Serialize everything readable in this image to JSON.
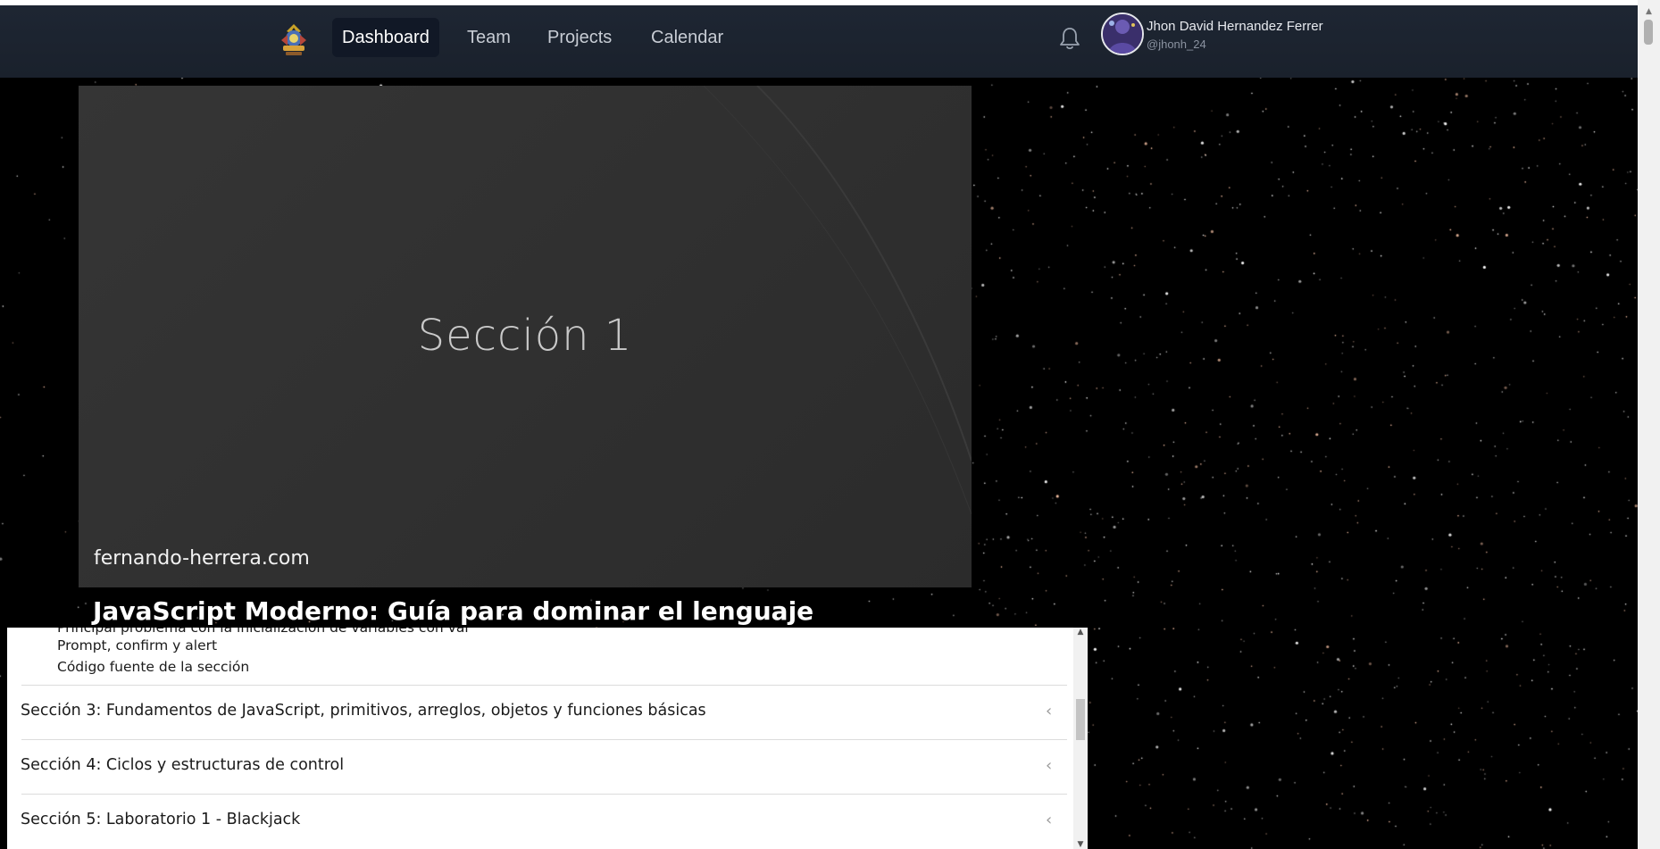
{
  "nav": {
    "logo_icon": "app-logo-icon",
    "items": [
      {
        "label": "Dashboard",
        "active": true
      },
      {
        "label": "Team",
        "active": false
      },
      {
        "label": "Projects",
        "active": false
      },
      {
        "label": "Calendar",
        "active": false
      }
    ],
    "notifications_icon": "bell-icon",
    "user": {
      "name": "Jhon David Hernandez Ferrer",
      "handle": "@jhonh_24"
    }
  },
  "video": {
    "slide_title": "Sección 1",
    "site": "fernando-herrera.com"
  },
  "course": {
    "title": "JavaScript Moderno: Guía para dominar el lenguaje"
  },
  "content": {
    "lessons": [
      "Principal problema con la inicialización de variables con var",
      "Prompt, confirm y alert",
      "Código fuente de la sección"
    ],
    "sections": [
      "Sección 3: Fundamentos de JavaScript, primitivos, arreglos, objetos y funciones básicas",
      "Sección 4: Ciclos y estructuras de control",
      "Sección 5: Laboratorio 1 - Blackjack"
    ],
    "chevron_icon": "chevron-left-icon"
  },
  "colors": {
    "navbar": "#1e2633",
    "active_nav": "#111826",
    "background": "#000000",
    "video": "#333333"
  }
}
